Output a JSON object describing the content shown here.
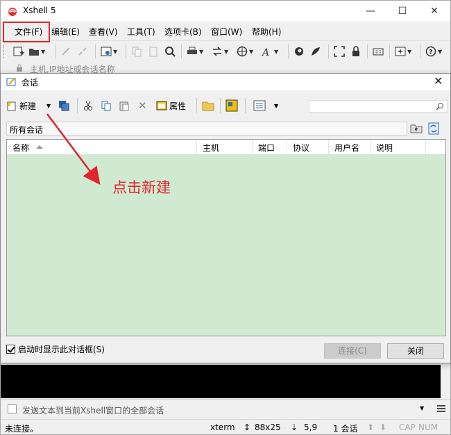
{
  "app": {
    "title": "Xshell 5",
    "window_controls": {
      "minimize": "—",
      "maximize": "☐",
      "close": "✕"
    }
  },
  "menubar": {
    "items": [
      "文件(F)",
      "编辑(E)",
      "查看(V)",
      "工具(T)",
      "选项卡(B)",
      "窗口(W)",
      "帮助(H)"
    ]
  },
  "address_bar": {
    "placeholder": "主机,IP地址或会话名称"
  },
  "dialog": {
    "title": "会话",
    "toolbar": {
      "new_label": "新建",
      "properties_label": "属性"
    },
    "path": "所有会话",
    "columns": [
      "名称",
      "主机",
      "端口",
      "协议",
      "用户名",
      "说明"
    ],
    "startup_checkbox": "启动时显示此对话框(S)",
    "connect_button": "连接(C)",
    "close_button": "关闭"
  },
  "annotation": {
    "text": "点击新建"
  },
  "sendbar": {
    "text": "发送文本到当前Xshell窗口的全部会话"
  },
  "statusbar": {
    "connection": "未连接。",
    "terminal": "xterm",
    "size": "88x25",
    "position": "5,9",
    "sessions": "1 会话",
    "cap": "CAP",
    "num": "NUM"
  },
  "colors": {
    "annotation_red": "#e0262a",
    "list_background": "#d0ead2"
  }
}
